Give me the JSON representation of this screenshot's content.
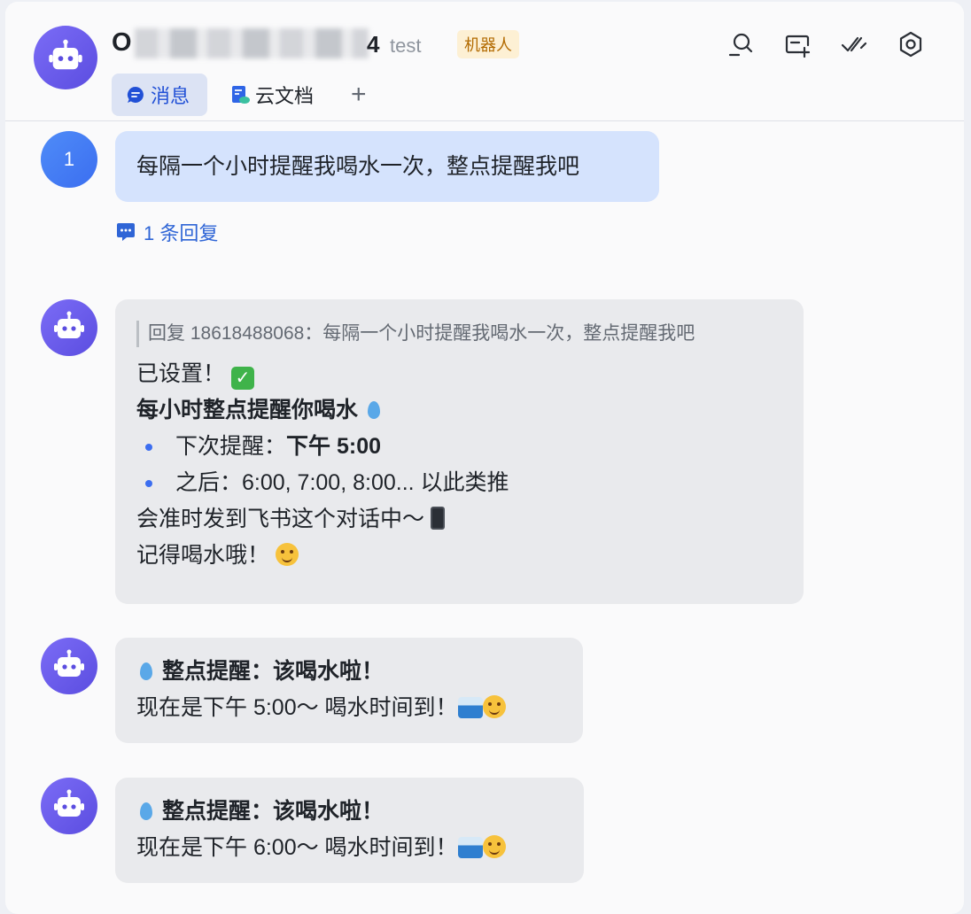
{
  "header": {
    "title_initial": "O",
    "title_tail": "4",
    "subtitle": "test",
    "badge": "机器人",
    "tabs": [
      {
        "label": "消息"
      },
      {
        "label": "云文档"
      }
    ],
    "add_tab": "+",
    "actions": [
      "search-icon",
      "create-group-icon",
      "mark-read-icon",
      "settings-icon"
    ]
  },
  "messages": [
    {
      "sender": "user",
      "avatar_text": "1",
      "text": "每隔一个小时提醒我喝水一次，整点提醒我吧",
      "reply_count_text": "1 条回复"
    },
    {
      "sender": "bot",
      "quote": "回复 18618488068：每隔一个小时提醒我喝水一次，整点提醒我吧",
      "line1": "已设置！",
      "heading": "每小时整点提醒你喝水",
      "bullet1_label": "下次提醒：",
      "bullet1_value": "下午 5:00",
      "bullet2": "之后：6:00, 7:00, 8:00... 以此类推",
      "line_send": "会准时发到飞书这个对话中～",
      "line_remember": "记得喝水哦！"
    },
    {
      "sender": "bot",
      "heading": "整点提醒：该喝水啦！",
      "body": "现在是下午 5:00～ 喝水时间到！"
    },
    {
      "sender": "bot",
      "heading": "整点提醒：该喝水啦！",
      "body": "现在是下午 6:00～ 喝水时间到！"
    }
  ],
  "colors": {
    "accent": "#2150d6",
    "user_bubble": "#d5e3fd",
    "bot_bubble": "#e9eaed",
    "bot_avatar": "#6a5cf0",
    "badge_bg": "#fdf0d4"
  }
}
